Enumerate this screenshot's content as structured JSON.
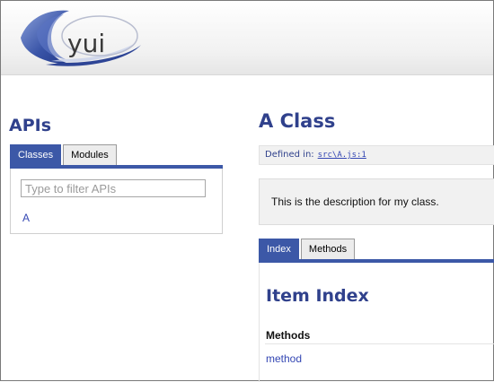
{
  "header": {
    "logo_text": "yui"
  },
  "sidebar": {
    "title": "APIs",
    "tabs": [
      {
        "label": "Classes",
        "active": true
      },
      {
        "label": "Modules",
        "active": false
      }
    ],
    "filter_placeholder": "Type to filter APIs",
    "filter_value": "",
    "classes": [
      "A"
    ]
  },
  "main": {
    "title": "A Class",
    "defined_in_label": "Defined in:",
    "defined_in_file": "src\\A.js:1",
    "description": "This is the description for my class.",
    "tabs": [
      {
        "label": "Index",
        "active": true
      },
      {
        "label": "Methods",
        "active": false
      }
    ],
    "item_index_title": "Item Index",
    "methods_heading": "Methods",
    "methods": [
      "method"
    ]
  },
  "colors": {
    "accent": "#3c58a7",
    "title": "#30418c",
    "link": "#3346b3",
    "panel_bg": "#f1f1f1"
  },
  "icons": [
    "yui-logo"
  ]
}
